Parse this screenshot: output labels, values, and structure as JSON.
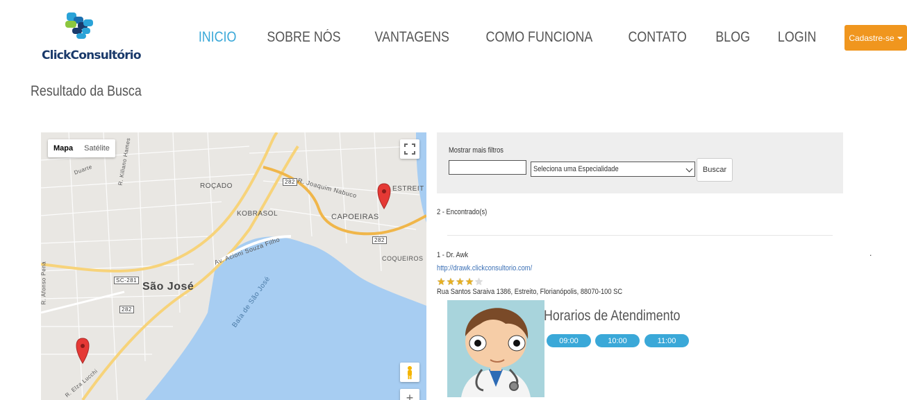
{
  "brand": {
    "name": "ClickConsultório"
  },
  "nav": {
    "items": [
      {
        "label": "INICIO",
        "active": true
      },
      {
        "label": "SOBRE NÓS",
        "active": false
      },
      {
        "label": "VANTAGENS",
        "active": false
      },
      {
        "label": "COMO FUNCIONA",
        "active": false
      },
      {
        "label": "CONTATO",
        "active": false
      },
      {
        "label": "BLOG",
        "active": false
      },
      {
        "label": "LOGIN",
        "active": false
      }
    ],
    "cta_label": "Cadastre-se"
  },
  "page": {
    "title": "Resultado da Busca"
  },
  "map": {
    "type_options": [
      "Mapa",
      "Satélite"
    ],
    "selected_type": "Mapa",
    "labels": {
      "rocado": "ROÇADO",
      "kobrasol": "KOBRASOL",
      "capoeiras": "CAPOEIRAS",
      "estreito": "ESTREIT",
      "coqueiros": "COQUEIROS",
      "sao_jose": "São José",
      "baia": "Baía de São José",
      "av_aciori": "Av. Acioni Souza Filho",
      "r_joaquim": "R. Joaquim Nabuco",
      "r_kiliano": "R. Kiliano Hames",
      "r_afonso": "R. Afonso Pena",
      "duarte": "Duarte",
      "elza": "R. Elza Lucchi",
      "sc281": "SC-281",
      "r282a": "282",
      "r282b": "282",
      "r282c": "282"
    }
  },
  "filters": {
    "more_filters_label": "Mostrar mais filtros",
    "text_value": "",
    "specialty_value": "Seleciona uma Especialidade",
    "search_label": "Buscar"
  },
  "results": {
    "count_text": "2 - Encontrado(s)",
    "items": [
      {
        "name": "1 - Dr. Awk",
        "url": "http://drawk.clickconsultorio.com/",
        "rating": 4,
        "rating_max": 5,
        "address": "Rua Santos Saraiva 1386, Estreito, Florianópolis, 88070-100 SC",
        "hours_title": "Horarios de Atendimento",
        "slots": [
          "09:00",
          "10:00",
          "11:00"
        ]
      }
    ]
  },
  "colors": {
    "accent": "#3aa8d8",
    "cta": "#f0961e",
    "marker": "#e53935"
  }
}
